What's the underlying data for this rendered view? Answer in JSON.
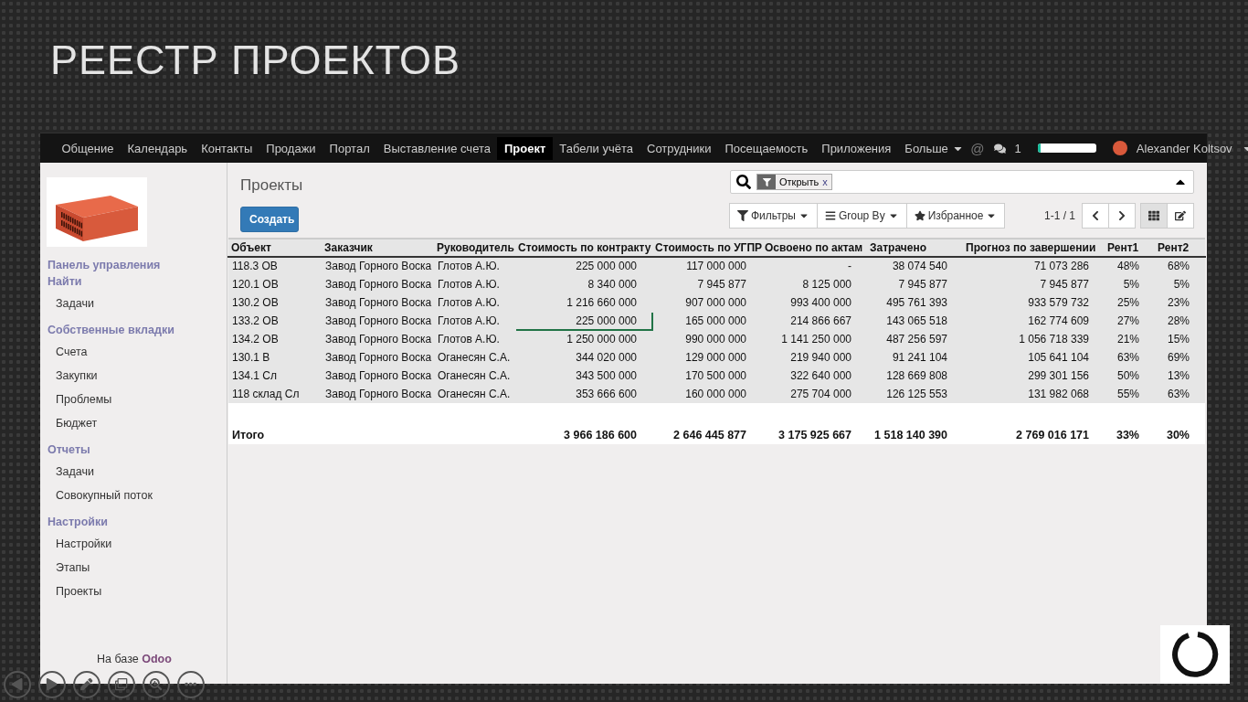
{
  "slide_title": "РЕЕСТР ПРОЕКТОВ",
  "navbar": {
    "items": [
      {
        "label": "Общение",
        "selected": false
      },
      {
        "label": "Календарь",
        "selected": false
      },
      {
        "label": "Контакты",
        "selected": false
      },
      {
        "label": "Продажи",
        "selected": false
      },
      {
        "label": "Портал",
        "selected": false
      },
      {
        "label": "Выставление счета",
        "selected": false
      },
      {
        "label": "Проект",
        "selected": true
      },
      {
        "label": "Табели учёта",
        "selected": false
      },
      {
        "label": "Сотрудники",
        "selected": false
      },
      {
        "label": "Посещаемость",
        "selected": false
      },
      {
        "label": "Приложения",
        "selected": false
      },
      {
        "label": "Больше",
        "selected": false,
        "dropdown": true
      }
    ],
    "mention_symbol": "@",
    "messages_count": "1",
    "progress": {
      "level": 0.05
    },
    "user": "Alexander Koltsov"
  },
  "sidebar": {
    "sections": [
      {
        "title": "Панель управления"
      },
      {
        "title": "Найти",
        "items": [
          "Задачи"
        ]
      },
      {
        "title": "Собственные вкладки",
        "items": [
          "Счета",
          "Закупки",
          "Проблемы",
          "Бюджет"
        ]
      },
      {
        "title": "Отчеты",
        "items": [
          "Задачи",
          "Совокупный поток"
        ]
      },
      {
        "title": "Настройки",
        "items": [
          "Настройки",
          "Этапы",
          "Проекты"
        ]
      }
    ],
    "powered_by": {
      "text": "На базе",
      "brand": "Odoo"
    }
  },
  "page_title": "Проекты",
  "create_button": "Создать",
  "search": {
    "facet": "Открыть",
    "facet_remove": "x"
  },
  "search_buttons": [
    {
      "kind": "filter",
      "label": "Фильтры"
    },
    {
      "kind": "group",
      "label": "Group By"
    },
    {
      "kind": "favorite",
      "label": "Избранное"
    }
  ],
  "pager": "1-1 / 1",
  "views": [
    {
      "kind": "kanban",
      "selected": true
    },
    {
      "kind": "form",
      "selected": false
    }
  ],
  "table": {
    "columns": [
      "Объект",
      "Заказчик",
      "Руководитель",
      "Стоимость по контракту",
      "Стоимость по УГПР",
      "Освоено по актам",
      "Затрачено",
      "Прогноз по завершении",
      "Рент1",
      "Рент2"
    ],
    "rows": [
      [
        {
          "text": "118.3 ОВ",
          "selected": false
        },
        {
          "text": "Завод Горного Воска",
          "selected": false
        },
        {
          "text": "Глотов А.Ю.",
          "selected": false
        },
        {
          "text": "225 000 000",
          "selected": false
        },
        {
          "text": "117 000 000",
          "selected": false
        },
        {
          "text": "-",
          "selected": false
        },
        {
          "text": "38 074 540",
          "selected": false
        },
        {
          "text": "71 073 286",
          "selected": false
        },
        {
          "text": "48%",
          "selected": false
        },
        {
          "text": "68%",
          "selected": false
        }
      ],
      [
        {
          "text": "120.1 ОВ",
          "selected": false
        },
        {
          "text": "Завод Горного Воска",
          "selected": false
        },
        {
          "text": "Глотов А.Ю.",
          "selected": false
        },
        {
          "text": "8 340 000",
          "selected": false
        },
        {
          "text": "7 945 877",
          "selected": false
        },
        {
          "text": "8 125 000",
          "selected": false
        },
        {
          "text": "7 945 877",
          "selected": false
        },
        {
          "text": "7 945 877",
          "selected": false
        },
        {
          "text": "5%",
          "selected": false
        },
        {
          "text": "5%",
          "selected": false
        }
      ],
      [
        {
          "text": "130.2 ОВ",
          "selected": false
        },
        {
          "text": "Завод Горного Воска",
          "selected": false
        },
        {
          "text": "Глотов А.Ю.",
          "selected": false
        },
        {
          "text": "1 216 660 000",
          "selected": false
        },
        {
          "text": "907 000 000",
          "selected": false
        },
        {
          "text": "993 400 000",
          "selected": false
        },
        {
          "text": "495 761 393",
          "selected": false
        },
        {
          "text": "933 579 732",
          "selected": false
        },
        {
          "text": "25%",
          "selected": false
        },
        {
          "text": "23%",
          "selected": false
        }
      ],
      [
        {
          "text": "133.2 ОВ",
          "selected": false
        },
        {
          "text": "Завод Горного Воска",
          "selected": false
        },
        {
          "text": "Глотов А.Ю.",
          "selected": false
        },
        {
          "text": "225 000 000",
          "selected": true
        },
        {
          "text": "165 000 000",
          "selected": false
        },
        {
          "text": "214 866 667",
          "selected": false
        },
        {
          "text": "143 065 518",
          "selected": false
        },
        {
          "text": "162 774 609",
          "selected": false
        },
        {
          "text": "27%",
          "selected": false
        },
        {
          "text": "28%",
          "selected": false
        }
      ],
      [
        {
          "text": "134.2 ОВ",
          "selected": false
        },
        {
          "text": "Завод Горного Воска",
          "selected": false
        },
        {
          "text": "Глотов А.Ю.",
          "selected": false
        },
        {
          "text": "1 250 000 000",
          "selected": false
        },
        {
          "text": "990 000 000",
          "selected": false
        },
        {
          "text": "1 141 250 000",
          "selected": false
        },
        {
          "text": "487 256 597",
          "selected": false
        },
        {
          "text": "1 056 718 339",
          "selected": false
        },
        {
          "text": "21%",
          "selected": false
        },
        {
          "text": "15%",
          "selected": false
        }
      ],
      [
        {
          "text": "130.1 В",
          "selected": false
        },
        {
          "text": "Завод Горного Воска",
          "selected": false
        },
        {
          "text": "Оганесян С.А.",
          "selected": false
        },
        {
          "text": "344 020 000",
          "selected": false
        },
        {
          "text": "129 000 000",
          "selected": false
        },
        {
          "text": "219 940 000",
          "selected": false
        },
        {
          "text": "91 241 104",
          "selected": false
        },
        {
          "text": "105 641 104",
          "selected": false
        },
        {
          "text": "63%",
          "selected": false
        },
        {
          "text": "69%",
          "selected": false
        }
      ],
      [
        {
          "text": "134.1 Сл",
          "selected": false
        },
        {
          "text": "Завод Горного Воска",
          "selected": false
        },
        {
          "text": "Оганесян С.А.",
          "selected": false
        },
        {
          "text": "343 500 000",
          "selected": false
        },
        {
          "text": "170 500 000",
          "selected": false
        },
        {
          "text": "322 640 000",
          "selected": false
        },
        {
          "text": "128 669 808",
          "selected": false
        },
        {
          "text": "299 301 156",
          "selected": false
        },
        {
          "text": "50%",
          "selected": false
        },
        {
          "text": "13%",
          "selected": false
        }
      ],
      [
        {
          "text": "118 склад Сл",
          "selected": false
        },
        {
          "text": "Завод Горного Воска",
          "selected": false
        },
        {
          "text": "Оганесян С.А.",
          "selected": false
        },
        {
          "text": "353 666 600",
          "selected": false
        },
        {
          "text": "160 000 000",
          "selected": false
        },
        {
          "text": "275 704 000",
          "selected": false
        },
        {
          "text": "126 125 553",
          "selected": false
        },
        {
          "text": "131 982 068",
          "selected": false
        },
        {
          "text": "55%",
          "selected": false
        },
        {
          "text": "63%",
          "selected": false
        }
      ]
    ],
    "totals": {
      "label": "Итого",
      "values": [
        "3 966 186 600",
        "2 646 445 877",
        "3 175 925 667",
        "1 518 140 390",
        "2 769 016 171",
        "33%",
        "30%"
      ]
    }
  }
}
